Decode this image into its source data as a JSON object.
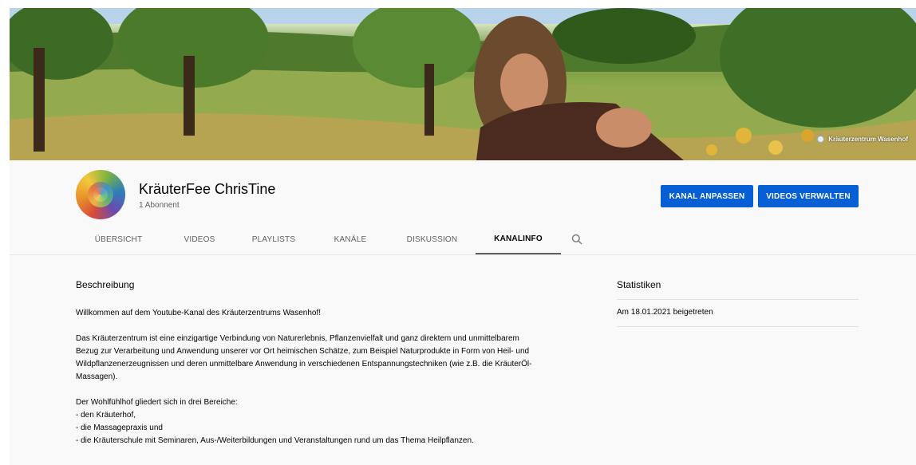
{
  "banner": {
    "brand_text": "Kräuterzentrum Wasenhof",
    "brand_icon": "channel-logo-icon"
  },
  "channel": {
    "name": "KräuterFee ChrisTine",
    "subscribers": "1 Abonnent"
  },
  "buttons": {
    "customize": "KANAL ANPASSEN",
    "manage": "VIDEOS VERWALTEN",
    "color": "#065fd4"
  },
  "tabs": [
    {
      "label": "ÜBERSICHT",
      "active": false
    },
    {
      "label": "VIDEOS",
      "active": false
    },
    {
      "label": "PLAYLISTS",
      "active": false
    },
    {
      "label": "KANÄLE",
      "active": false
    },
    {
      "label": "DISKUSSION",
      "active": false
    },
    {
      "label": "KANALINFO",
      "active": true
    }
  ],
  "search_icon": "search-icon",
  "about": {
    "description_title": "Beschreibung",
    "description": "Willkommen auf dem Youtube-Kanal des Kräuterzentrums Wasenhof!\n\nDas Kräuterzentrum ist eine einzigartige Verbindung von Naturerlebnis, Pflanzenvielfalt und ganz direktem und unmittelbarem\nBezug zur Verarbeitung und Anwendung unserer vor Ort heimischen Schätze, zum Beispiel Naturprodukte in Form von Heil- und\nWildpflanzenerzeugnissen und deren unmittelbare Anwendung in verschiedenen Entspannungstechniken (wie z.B. die KräuterÖl-\nMassagen).\n\nDer Wohlfühlhof gliedert sich in drei Bereiche:\n- den Kräuterhof,\n- die Massagepraxis und\n- die Kräuterschule mit Seminaren, Aus-/Weiterbildungen und Veranstaltungen rund um das Thema Heilpflanzen.",
    "stats_title": "Statistiken",
    "joined": "Am 18.01.2021 beigetreten"
  }
}
